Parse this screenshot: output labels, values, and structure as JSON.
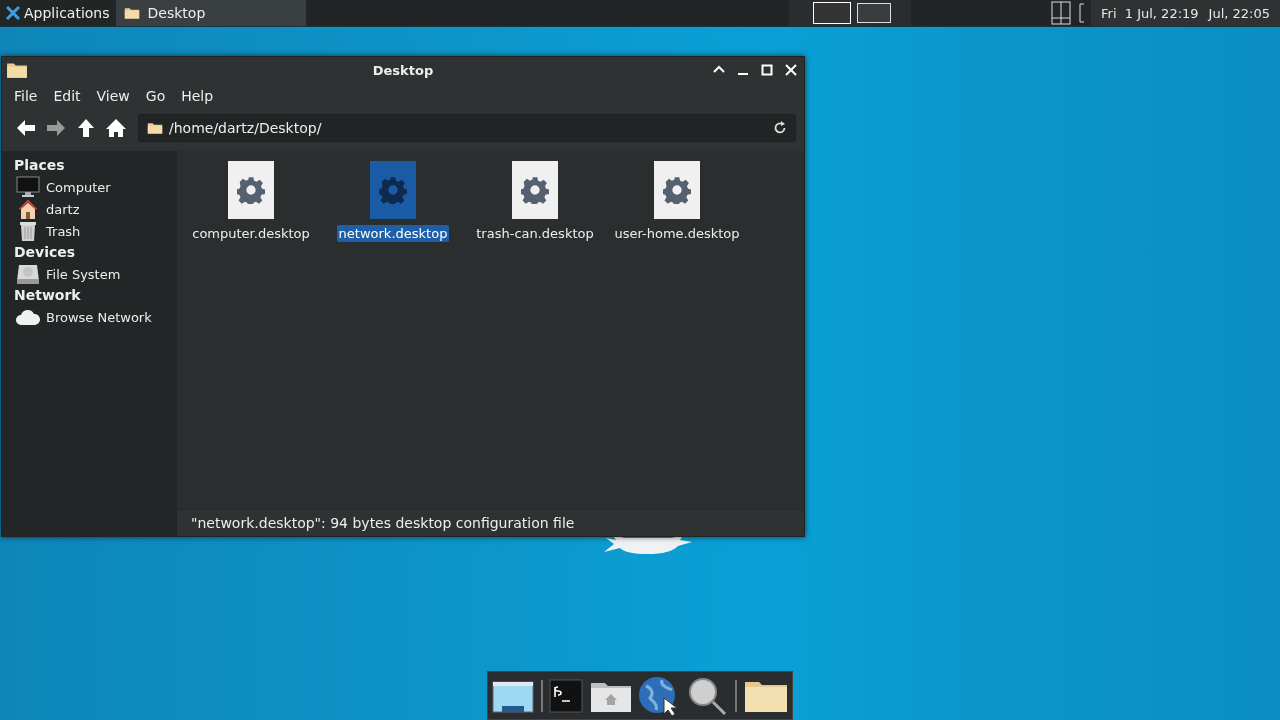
{
  "panel": {
    "menu_label": "Applications",
    "tasks": [
      {
        "label": "Desktop",
        "selected": true
      }
    ],
    "workspaces": [
      {
        "selected": true
      },
      {
        "selected": false
      }
    ],
    "clock": "Fri  1 Jul, 22:19",
    "clock_2": "Jul, 22:05"
  },
  "window": {
    "title": "Desktop",
    "menu": [
      "File",
      "Edit",
      "View",
      "Go",
      "Help"
    ],
    "location": "/home/dartz/Desktop/",
    "sidebar": [
      {
        "heading": "Places",
        "items": [
          {
            "label": "Computer",
            "kind": "computer"
          },
          {
            "label": "dartz",
            "kind": "home"
          },
          {
            "label": "Trash",
            "kind": "trash"
          }
        ]
      },
      {
        "heading": "Devices",
        "items": [
          {
            "label": "File System",
            "kind": "drive"
          }
        ]
      },
      {
        "heading": "Network",
        "items": [
          {
            "label": "Browse Network",
            "kind": "network"
          }
        ]
      }
    ],
    "files": [
      {
        "name": "computer.desktop",
        "selected": false
      },
      {
        "name": "network.desktop",
        "selected": true
      },
      {
        "name": "trash-can.desktop",
        "selected": false
      },
      {
        "name": "user-home.desktop",
        "selected": false
      }
    ],
    "status": "\"network.desktop\": 94 bytes desktop configuration file"
  },
  "dock": [
    {
      "kind": "desktop"
    },
    {
      "kind": "separator"
    },
    {
      "kind": "terminal"
    },
    {
      "kind": "home-folder"
    },
    {
      "kind": "globe"
    },
    {
      "kind": "search"
    },
    {
      "kind": "separator"
    },
    {
      "kind": "folder"
    }
  ]
}
